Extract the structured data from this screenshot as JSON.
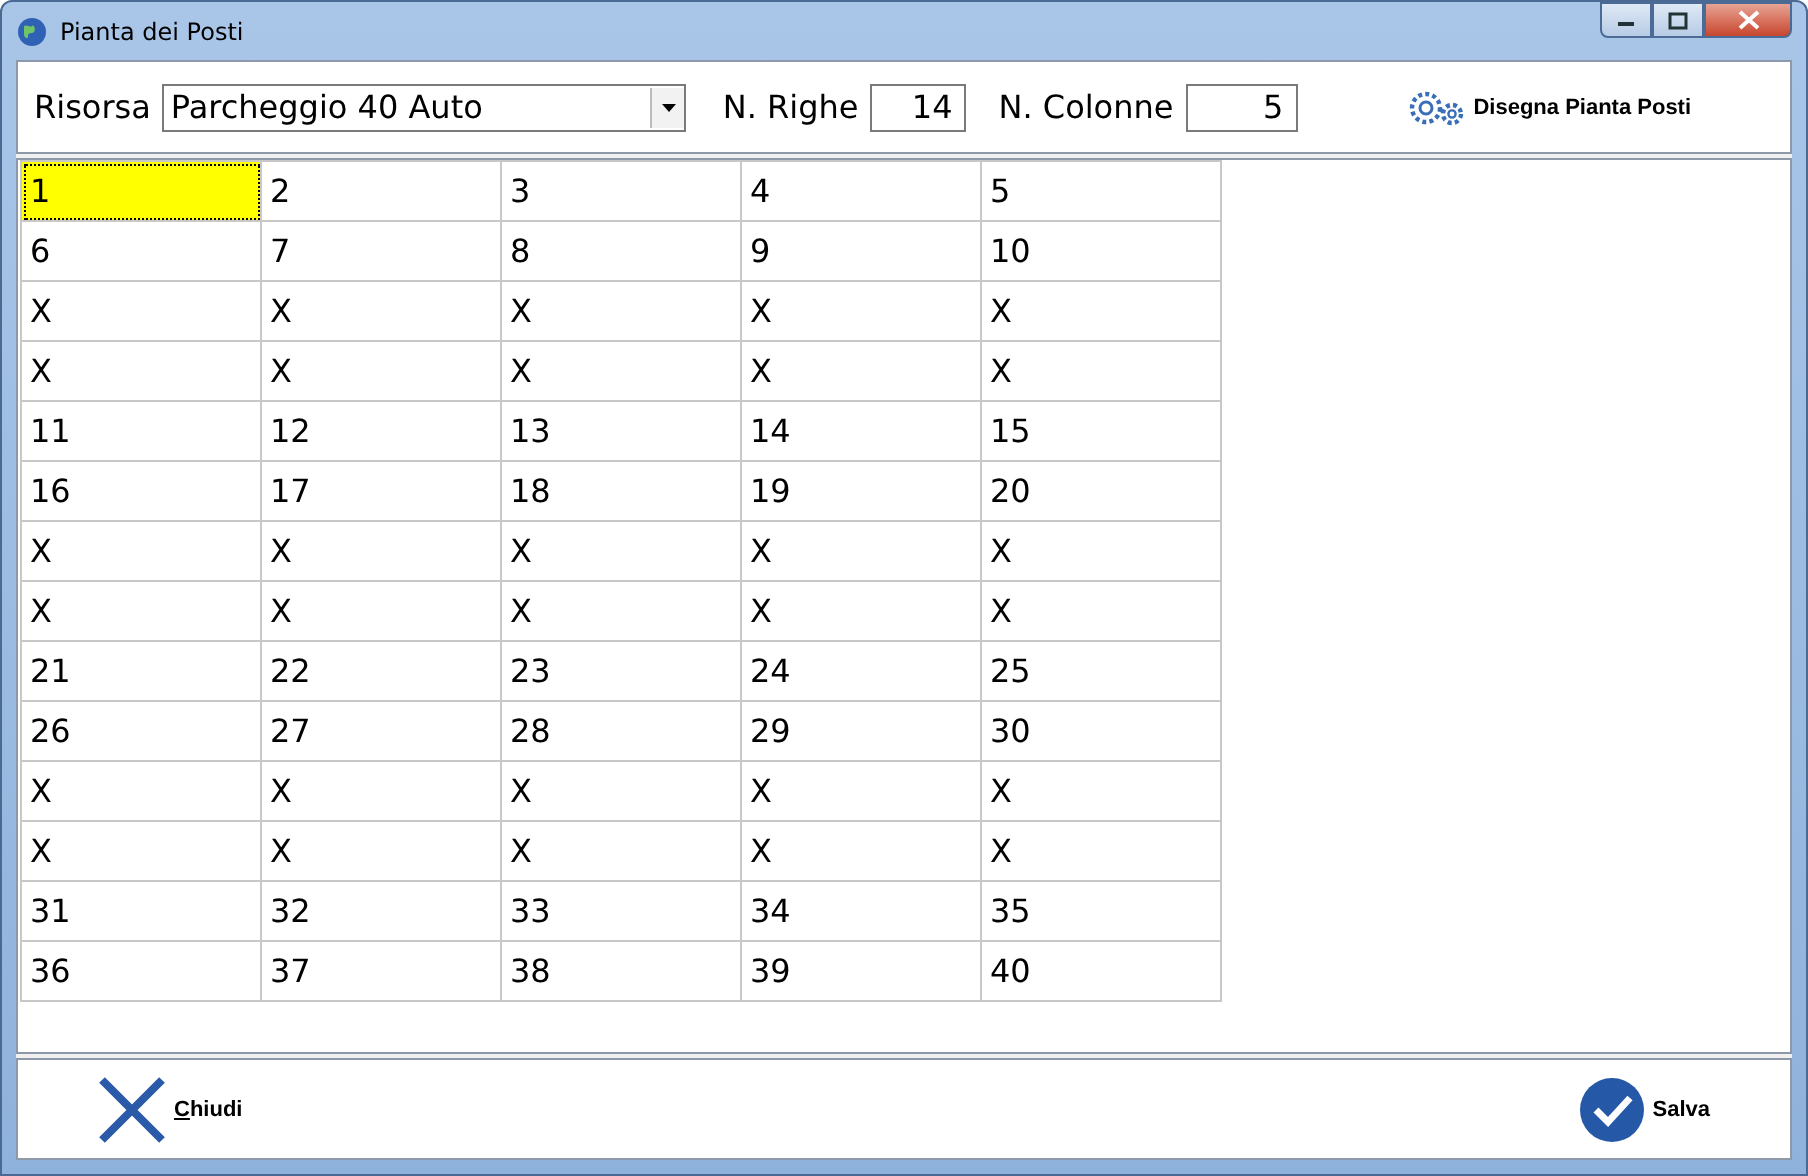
{
  "window": {
    "title": "Pianta dei Posti"
  },
  "toolbar": {
    "resource_label": "Risorsa",
    "resource_value": "Parcheggio 40 Auto",
    "rows_label": "N. Righe",
    "rows_value": "14",
    "columns_label": "N. Colonne",
    "columns_value": "5",
    "draw_button": "Disegna Pianta Posti"
  },
  "grid": {
    "rows": [
      [
        {
          "text": "1",
          "selected": true
        },
        {
          "text": "2",
          "selected": false
        },
        {
          "text": "3",
          "selected": false
        },
        {
          "text": "4",
          "selected": false
        },
        {
          "text": "5",
          "selected": false
        }
      ],
      [
        {
          "text": "6",
          "selected": false
        },
        {
          "text": "7",
          "selected": false
        },
        {
          "text": "8",
          "selected": false
        },
        {
          "text": "9",
          "selected": false
        },
        {
          "text": "10",
          "selected": false
        }
      ],
      [
        {
          "text": "X",
          "selected": false
        },
        {
          "text": "X",
          "selected": false
        },
        {
          "text": "X",
          "selected": false
        },
        {
          "text": "X",
          "selected": false
        },
        {
          "text": "X",
          "selected": false
        }
      ],
      [
        {
          "text": "X",
          "selected": false
        },
        {
          "text": "X",
          "selected": false
        },
        {
          "text": "X",
          "selected": false
        },
        {
          "text": "X",
          "selected": false
        },
        {
          "text": "X",
          "selected": false
        }
      ],
      [
        {
          "text": "11",
          "selected": false
        },
        {
          "text": "12",
          "selected": false
        },
        {
          "text": "13",
          "selected": false
        },
        {
          "text": "14",
          "selected": false
        },
        {
          "text": "15",
          "selected": false
        }
      ],
      [
        {
          "text": "16",
          "selected": false
        },
        {
          "text": "17",
          "selected": false
        },
        {
          "text": "18",
          "selected": false
        },
        {
          "text": "19",
          "selected": false
        },
        {
          "text": "20",
          "selected": false
        }
      ],
      [
        {
          "text": "X",
          "selected": false
        },
        {
          "text": "X",
          "selected": false
        },
        {
          "text": "X",
          "selected": false
        },
        {
          "text": "X",
          "selected": false
        },
        {
          "text": "X",
          "selected": false
        }
      ],
      [
        {
          "text": "X",
          "selected": false
        },
        {
          "text": "X",
          "selected": false
        },
        {
          "text": "X",
          "selected": false
        },
        {
          "text": "X",
          "selected": false
        },
        {
          "text": "X",
          "selected": false
        }
      ],
      [
        {
          "text": "21",
          "selected": false
        },
        {
          "text": "22",
          "selected": false
        },
        {
          "text": "23",
          "selected": false
        },
        {
          "text": "24",
          "selected": false
        },
        {
          "text": "25",
          "selected": false
        }
      ],
      [
        {
          "text": "26",
          "selected": false
        },
        {
          "text": "27",
          "selected": false
        },
        {
          "text": "28",
          "selected": false
        },
        {
          "text": "29",
          "selected": false
        },
        {
          "text": "30",
          "selected": false
        }
      ],
      [
        {
          "text": "X",
          "selected": false
        },
        {
          "text": "X",
          "selected": false
        },
        {
          "text": "X",
          "selected": false
        },
        {
          "text": "X",
          "selected": false
        },
        {
          "text": "X",
          "selected": false
        }
      ],
      [
        {
          "text": "X",
          "selected": false
        },
        {
          "text": "X",
          "selected": false
        },
        {
          "text": "X",
          "selected": false
        },
        {
          "text": "X",
          "selected": false
        },
        {
          "text": "X",
          "selected": false
        }
      ],
      [
        {
          "text": "31",
          "selected": false
        },
        {
          "text": "32",
          "selected": false
        },
        {
          "text": "33",
          "selected": false
        },
        {
          "text": "34",
          "selected": false
        },
        {
          "text": "35",
          "selected": false
        }
      ],
      [
        {
          "text": "36",
          "selected": false
        },
        {
          "text": "37",
          "selected": false
        },
        {
          "text": "38",
          "selected": false
        },
        {
          "text": "39",
          "selected": false
        },
        {
          "text": "40",
          "selected": false
        }
      ]
    ]
  },
  "footer": {
    "close_button": "Chiudi",
    "save_button": "Salva"
  }
}
